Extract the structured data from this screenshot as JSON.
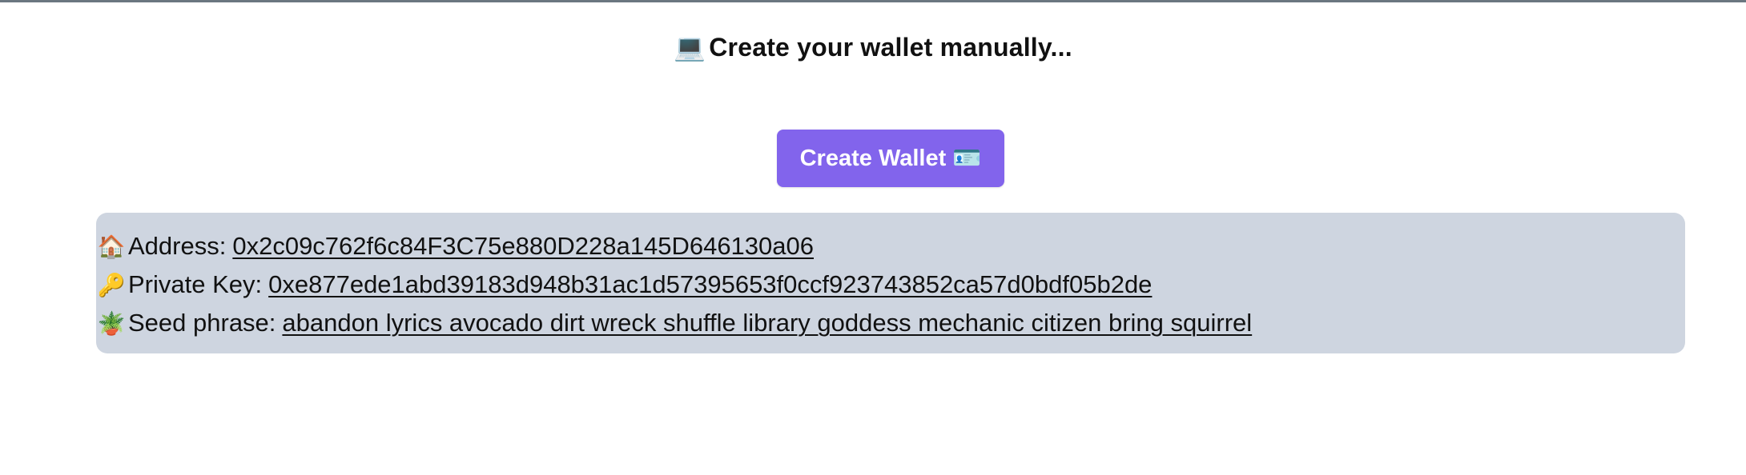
{
  "header": {
    "icon": "laptop-icon",
    "icon_glyph": "💻",
    "title": "Create your wallet manually..."
  },
  "create_button": {
    "label": "Create Wallet",
    "icon": "id-card-icon",
    "icon_glyph": "🪪",
    "color": "#8264ec"
  },
  "wallet_info": {
    "background": "#ced5e0",
    "address": {
      "icon": "house-icon",
      "icon_glyph": "🏠",
      "label": "Address:",
      "value": "0x2c09c762f6c84F3C75e880D228a145D646130a06"
    },
    "private_key": {
      "icon": "key-icon",
      "icon_glyph": "🔑",
      "label": "Private Key:",
      "value": "0xe877ede1abd39183d948b31ac1d57395653f0ccf923743852ca57d0bdf05b2de"
    },
    "seed_phrase": {
      "icon": "potted-plant-icon",
      "icon_glyph": "🪴",
      "label": "Seed phrase:",
      "value": "abandon lyrics avocado dirt wreck shuffle library goddess mechanic citizen bring squirrel"
    }
  }
}
